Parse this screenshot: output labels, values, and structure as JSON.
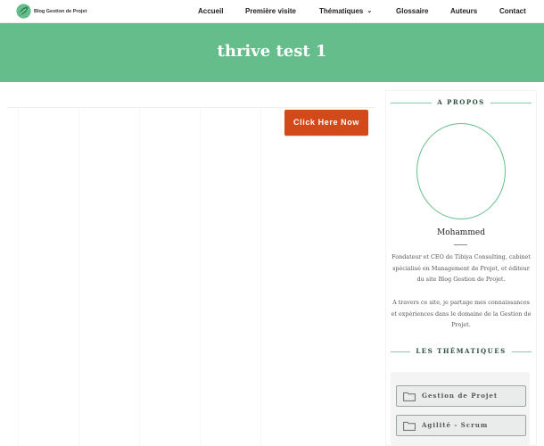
{
  "brand": {
    "name": "Blog Gestion de Projet",
    "accent": "#64bd8a",
    "cta_color": "#d24a19"
  },
  "nav": {
    "items": [
      {
        "label": "Accueil"
      },
      {
        "label": "Première visite"
      },
      {
        "label": "Thématiques"
      },
      {
        "label": "Glossaire"
      },
      {
        "label": "Auteurs"
      },
      {
        "label": "Contact"
      }
    ],
    "dropdown_icon": "chevron-down-icon"
  },
  "hero": {
    "title": "thrive test 1"
  },
  "main": {
    "cta_label": "Click Here Now"
  },
  "sidebar": {
    "about": {
      "heading": "A PROPOS",
      "author": "Mohammed",
      "bio_1": "Fondateur et CEO de Tibiya Consulting, cabinet spécialisé en Management de Projet, et éditeur du site Blog Gestion de Projet.",
      "bio_2": "A travers ce site, je partage mes connaissances et expériences dans le domaine de la Gestion de Projet."
    },
    "topics": {
      "heading": "LES THÉMATIQUES",
      "items": [
        {
          "label": "Gestion de Projet",
          "icon": "folder-icon"
        },
        {
          "label": "Agilité - Scrum",
          "icon": "folder-icon"
        }
      ]
    }
  }
}
